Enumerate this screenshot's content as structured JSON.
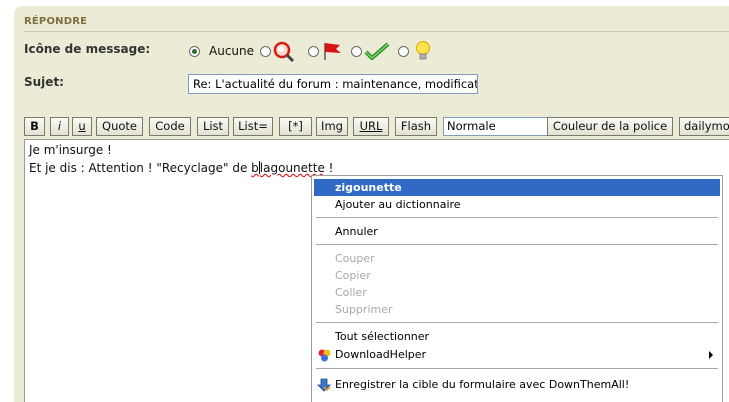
{
  "section": {
    "title": "RÉPONDRE"
  },
  "message_icon": {
    "label": "Icône de message:",
    "options": [
      {
        "label": "Aucune",
        "checked": true
      },
      {
        "icon": "magnifier-icon",
        "checked": false
      },
      {
        "icon": "red-flag-icon",
        "checked": false
      },
      {
        "icon": "green-checkmark-icon",
        "checked": false
      },
      {
        "icon": "lightbulb-icon",
        "checked": false
      }
    ]
  },
  "subject": {
    "label": "Sujet:",
    "value": "Re: L'actualité du forum : maintenance, modificat"
  },
  "toolbar": {
    "buttons": [
      "B",
      "i",
      "u",
      "Quote",
      "Code",
      "List",
      "List=",
      "[*]",
      "Img",
      "URL",
      "Flash"
    ],
    "size_select": "Normale",
    "color_button": "Couleur de la police",
    "extra_button": "dailymo"
  },
  "editor": {
    "line1": "Je m'insurge !",
    "line2_prefix": "Et je dis : Attention ! \"Recyclage\" de ",
    "line2_word_a": "b",
    "line2_word_b": "lagounette",
    "line2_suffix": " !"
  },
  "context_menu": {
    "suggestion": "zigounette",
    "add_dictionary": "Ajouter au dictionnaire",
    "undo": "Annuler",
    "cut": "Couper",
    "copy": "Copier",
    "paste": "Coller",
    "delete": "Supprimer",
    "select_all": "Tout sélectionner",
    "downloadhelper": "DownloadHelper",
    "downthemall": "Enregistrer la cible du formulaire avec DownThemAll!"
  },
  "colors": {
    "panel_bg": "#ecebd6",
    "section_title": "#7b6f3f",
    "highlight": "#316ac5",
    "spell_error": "#e00000"
  }
}
